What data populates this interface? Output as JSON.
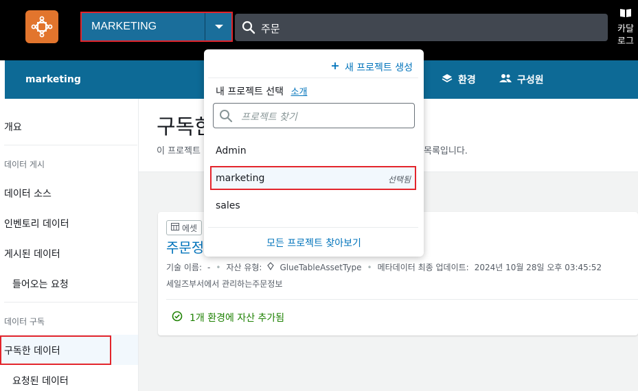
{
  "header": {
    "project_selector_value": "MARKETING",
    "search_value": "주문",
    "catalog_label": "카달\n로그"
  },
  "subnav": {
    "project_name": "marketing",
    "items": [
      {
        "label": "환경",
        "icon": "layers-icon"
      },
      {
        "label": "구성원",
        "icon": "users-icon"
      }
    ]
  },
  "sidebar": {
    "overview": "개요",
    "publish_section": "데이터 게시",
    "publish_items": [
      "데이터 소스",
      "인벤토리 데이터",
      "게시된 데이터",
      "들어오는 요청"
    ],
    "subscribe_section": "데이터 구독",
    "subscribe_items": [
      "구독한 데이터",
      "요청된 데이터"
    ]
  },
  "main": {
    "title": "구독한 데이터",
    "description_start": "이 프로젝트",
    "description_end": "목록입니다."
  },
  "asset_card": {
    "badge": "에셋",
    "title": "주문정보",
    "technical_name_label": "기술 이름:",
    "technical_name_value": "-",
    "asset_type_label": "자산 유형:",
    "asset_type_value": "GlueTableAssetType",
    "metadata_updated_label": "메타데이터 최종 업데이트:",
    "metadata_updated_value": "2024년 10월 28일 오후 03:45:52",
    "description": "세일즈부서에서 관리하는주문정보",
    "status": "1개 환경에 자산 추가됨"
  },
  "project_dropdown": {
    "create_label": "새 프로젝트 생성",
    "heading": "내 프로젝트 선택",
    "intro_link": "소개",
    "search_placeholder": "프로젝트 찾기",
    "projects": [
      "Admin",
      "marketing",
      "sales"
    ],
    "selected_tag": "선택됨",
    "browse_all": "모든 프로젝트 찾아보기"
  },
  "colors": {
    "top_bar": "#000000",
    "sub_nav": "#0d6a96",
    "project_selector": "#1a6e9b",
    "link": "#0073bb",
    "success": "#1d8102",
    "highlight": "#e3242b",
    "logo": "#e2752d"
  }
}
